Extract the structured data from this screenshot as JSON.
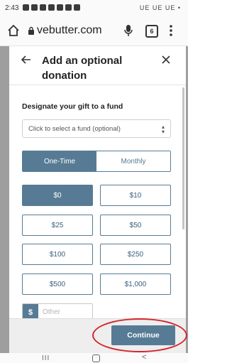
{
  "status_bar": {
    "time": "2:43",
    "right": "UE UE UE •"
  },
  "browser": {
    "url": "vebutter.com",
    "tab_count": "6"
  },
  "modal": {
    "title": "Add an optional donation",
    "fund_label": "Designate your gift to a fund",
    "fund_select_placeholder": "Click to select a fund (optional)",
    "frequency": {
      "one_time": "One-Time",
      "monthly": "Monthly",
      "selected": "One-Time"
    },
    "amounts": [
      "$0",
      "$10",
      "$25",
      "$50",
      "$100",
      "$250",
      "$500",
      "$1,000"
    ],
    "selected_amount": "$0",
    "other": {
      "prefix": "$",
      "placeholder": "Other"
    },
    "continue_label": "Continue"
  },
  "colors": {
    "accent": "#577b95",
    "highlight": "#d6232a"
  },
  "nav": {
    "recent": "III",
    "back": "<"
  }
}
